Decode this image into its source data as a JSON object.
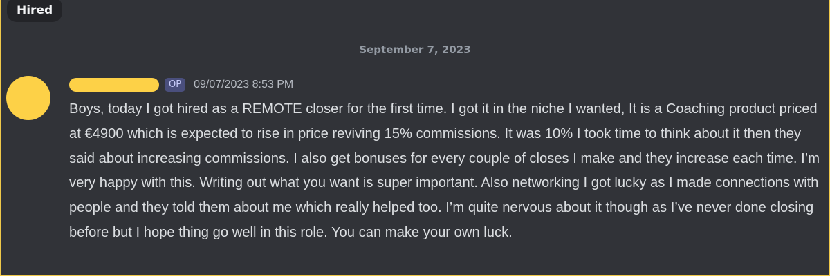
{
  "channel": {
    "tag_label": "Hired"
  },
  "divider": {
    "date": "September 7, 2023"
  },
  "message": {
    "op_badge": "OP",
    "timestamp": "09/07/2023 8:53 PM",
    "text": "Boys, today I got hired as a REMOTE closer for the first time. I got it in the niche I wanted, It is a Coaching product priced at €4900 which is expected to rise in price reviving 15% commissions. It was 10% I took time to think about it then they said about increasing commissions. I also get bonuses for every couple of closes I make and they increase each time. I’m very happy with this. Writing out what you want is super important. Also networking I got lucky as I made connections with people and they told them about me which really helped too. I’m quite nervous about it though as I’ve never done closing before but I hope thing go well in this role. You can make your own luck."
  },
  "colors": {
    "background": "#313338",
    "redaction": "#fdd147",
    "message_text": "#dbdee1",
    "muted_text": "#949ba4",
    "op_badge_bg": "#4a4f7d"
  }
}
